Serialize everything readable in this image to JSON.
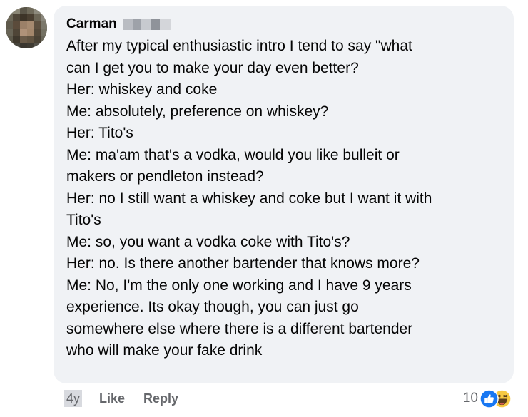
{
  "comment": {
    "author": "Carman",
    "lines": [
      "After my typical enthusiastic intro I tend to say \"what",
      "can I get you to make your day even better?",
      "Her: whiskey and coke",
      "Me: absolutely, preference on whiskey?",
      "Her: Tito's",
      "Me: ma'am that's a vodka, would you like bulleit or",
      "makers or pendleton instead?",
      "Her: no I still want a whiskey and coke but I want it with",
      "Tito's",
      "Me: so, you want a vodka coke with Tito's?",
      "Her: no. Is there another bartender that knows more?",
      "Me: No, I'm the only one working and I have 9 years",
      "experience. Its okay though, you can just go",
      "somewhere else where there is a different bartender",
      "who will make your fake drink"
    ]
  },
  "actions": {
    "age": "4y",
    "like_label": "Like",
    "reply_label": "Reply"
  },
  "reactions": {
    "count": "10",
    "icons": [
      "like-icon",
      "haha-icon"
    ]
  },
  "colors": {
    "bubble": "#f0f2f5",
    "text": "#050505",
    "muted": "#65676b",
    "like_blue": "#1877f2",
    "haha_yellow": "#f7c943"
  }
}
